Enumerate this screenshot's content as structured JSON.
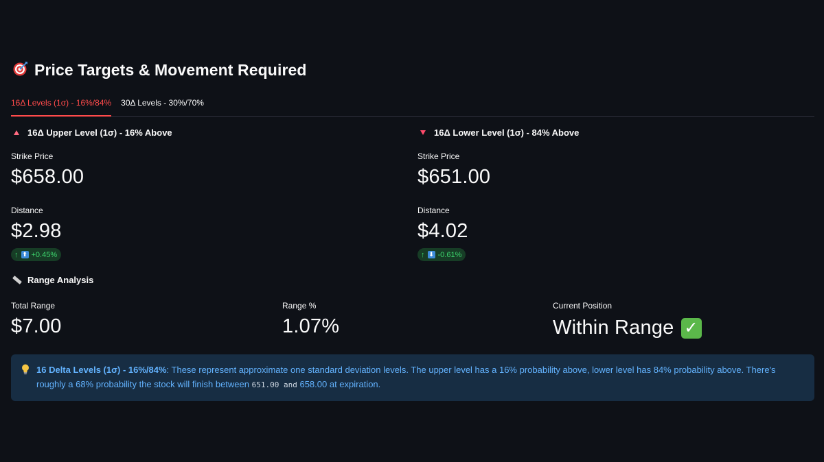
{
  "header": {
    "icon": "target-dart-icon",
    "title": "Price Targets & Movement Required"
  },
  "tabs": [
    {
      "label": "16Δ Levels (1σ) - 16%/84%",
      "active": true
    },
    {
      "label": "30Δ Levels - 30%/70%",
      "active": false
    }
  ],
  "upper": {
    "heading": "16Δ Upper Level (1σ) - 16% Above",
    "strike_label": "Strike Price",
    "strike_value": "$658.00",
    "distance_label": "Distance",
    "distance_value": "$2.98",
    "delta_text": "+0.45%"
  },
  "lower": {
    "heading": "16Δ Lower Level (1σ) - 84% Above",
    "strike_label": "Strike Price",
    "strike_value": "$651.00",
    "distance_label": "Distance",
    "distance_value": "$4.02",
    "delta_text": "-0.61%"
  },
  "range": {
    "heading": "Range Analysis",
    "total_label": "Total Range",
    "total_value": "$7.00",
    "pct_label": "Range %",
    "pct_value": "1.07%",
    "position_label": "Current Position",
    "position_value": "Within Range"
  },
  "info": {
    "bold": "16 Delta Levels (1σ) - 16%/84%",
    "text1": ": These represent approximate one standard deviation levels. The upper level has a 16% probability above, lower level has 84% probability above. There's roughly a 68% probability the stock will finish between ",
    "code": "651.00  and",
    "text2": " 658.00 at expiration."
  },
  "colors": {
    "background": "#0e1117",
    "accent": "#ff4b4b",
    "delta_positive": "#3dd56d",
    "info_bg": "#172d43",
    "info_text": "#63b3ff"
  }
}
